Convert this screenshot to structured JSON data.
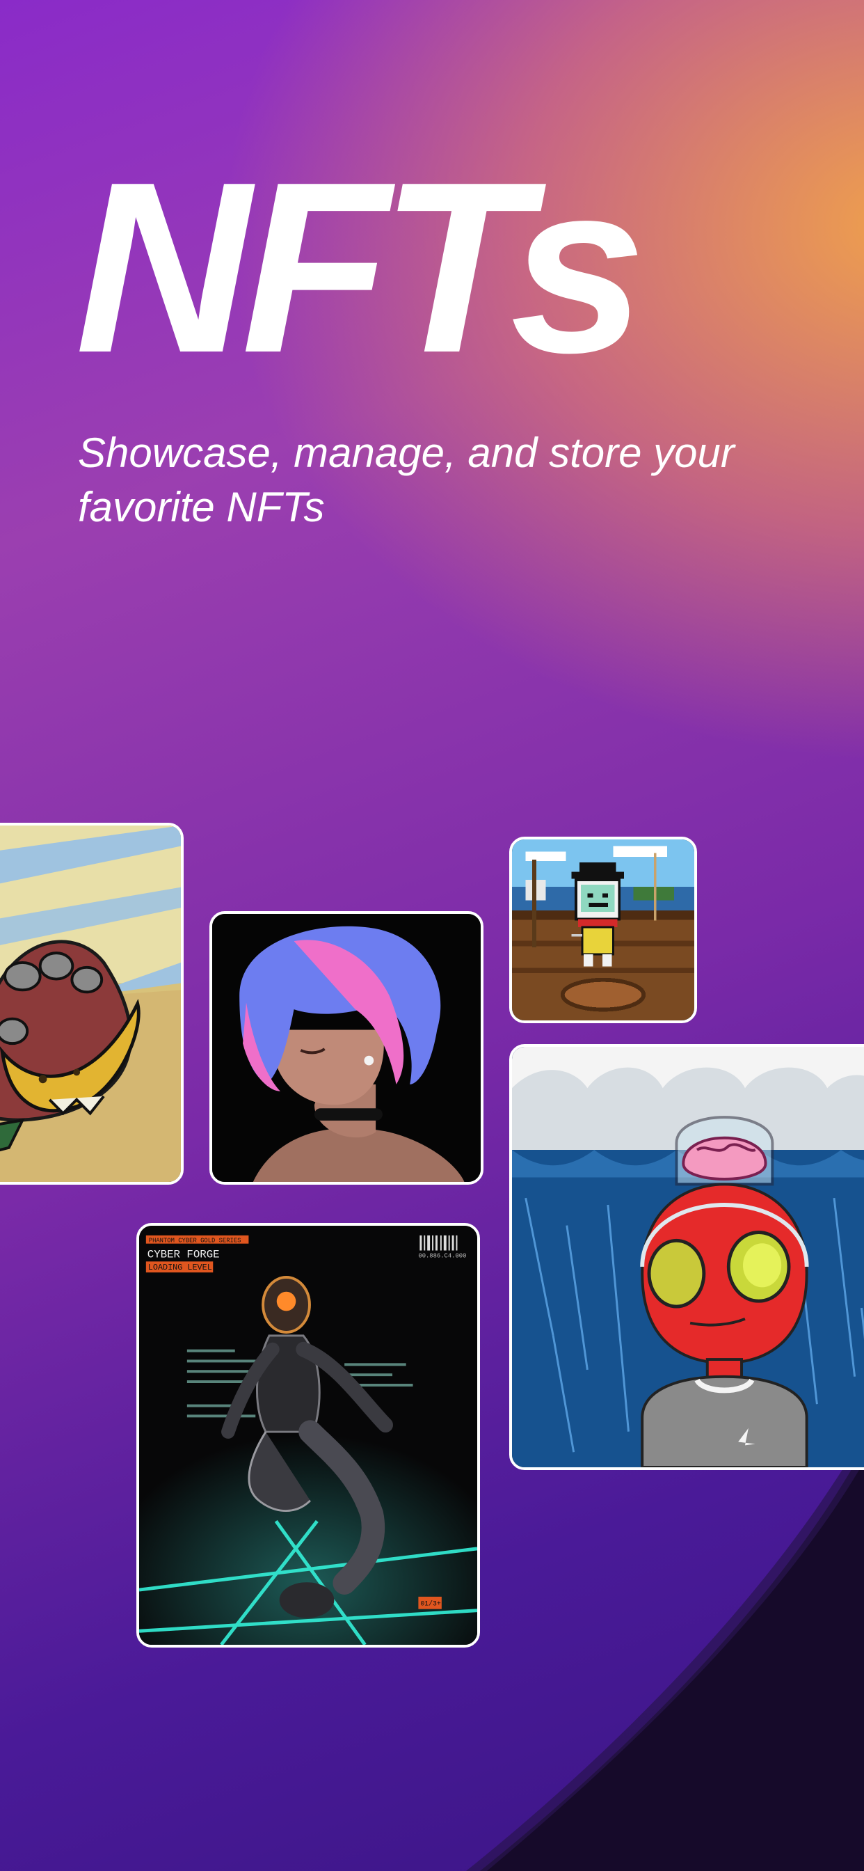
{
  "hero": {
    "title": "NFTs",
    "subtitle": "Showcase, manage, and store your favorite NFTs"
  },
  "cards": {
    "monkey_hand": {
      "icon": "monkey-hand-banana-art"
    },
    "anime_girl": {
      "icon": "anime-girl-portrait-art"
    },
    "pirate_robot": {
      "icon": "pixel-pirate-robot-art"
    },
    "red_alien": {
      "icon": "red-alien-brain-art"
    },
    "cyber_forge": {
      "icon": "cyber-forge-figure-art",
      "header_line": "PHANTOM CYBER GOLD SERIES",
      "brand": "CYBER FORGE",
      "loading": "LOADING LEVEL",
      "code": "00.886.C4.000",
      "tag": "01/3+"
    }
  },
  "colors": {
    "accent_orange": "#F0A24A",
    "accent_purple": "#8A2BC8",
    "deep_purple": "#3A1585"
  }
}
